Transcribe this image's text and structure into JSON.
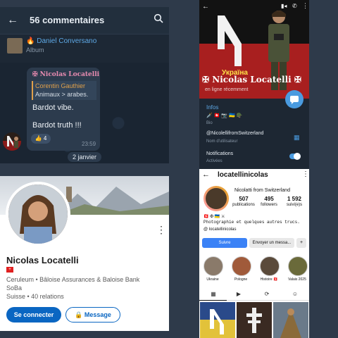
{
  "telegram_comments": {
    "back": "←",
    "title": "56 commentaires",
    "search_icon": "search-icon",
    "album_author": "🔥 Daniel Conversano",
    "album_label": "Album",
    "author": "✠ Nicolas Locatelli",
    "reply_name": "Corentin Gauthier",
    "reply_text": "Animaux > arabes.",
    "message1": "Bardot vibe.",
    "message2": "Bardot truth !!!",
    "reaction": "👍 4",
    "time": "23:59",
    "date": "2 janvier"
  },
  "telegram_profile": {
    "ukraina": "Україна",
    "name": "✠ Nicolas Locatelli ✠",
    "seen": "en ligne récemment",
    "infos": "Infos",
    "emojis": "🗡️ 🇨🇭 📷 🇺🇦 🪖",
    "bio_label": "Bio",
    "username": "@NicolellifromSwitzerland",
    "username_label": "Nom d'utilisateur",
    "notifications": "Notifications",
    "notifications_state": "Activées"
  },
  "linkedin": {
    "name": "Nicolas Locatelli",
    "flag": "+",
    "line1": "Ceruleum  •  Bâloise Assurances & Baloise Bank",
    "line2": "SoBa",
    "line3": "Suisse  •  40 relations",
    "connect": "Se connecter",
    "message": "🔒 Message"
  },
  "instagram": {
    "handle": "locatellinicolas",
    "display_name": "Nicolatti from Switzerland",
    "stats": [
      {
        "value": "507",
        "label": "publications"
      },
      {
        "value": "495",
        "label": "followers"
      },
      {
        "value": "1 592",
        "label": "suivi(e)s"
      }
    ],
    "flags": "🇨🇭 ✠ 🇺🇦 ⚔",
    "bio": "Photographie et quelques autres trucs.",
    "link": "@ locatellinicolas",
    "follow": "Suivre",
    "message": "Envoyer un messa...",
    "add_icon": "+",
    "highlights": [
      "Ukraine",
      "Pologne",
      "Histoire 🇨🇭",
      "Valais 2025"
    ]
  }
}
